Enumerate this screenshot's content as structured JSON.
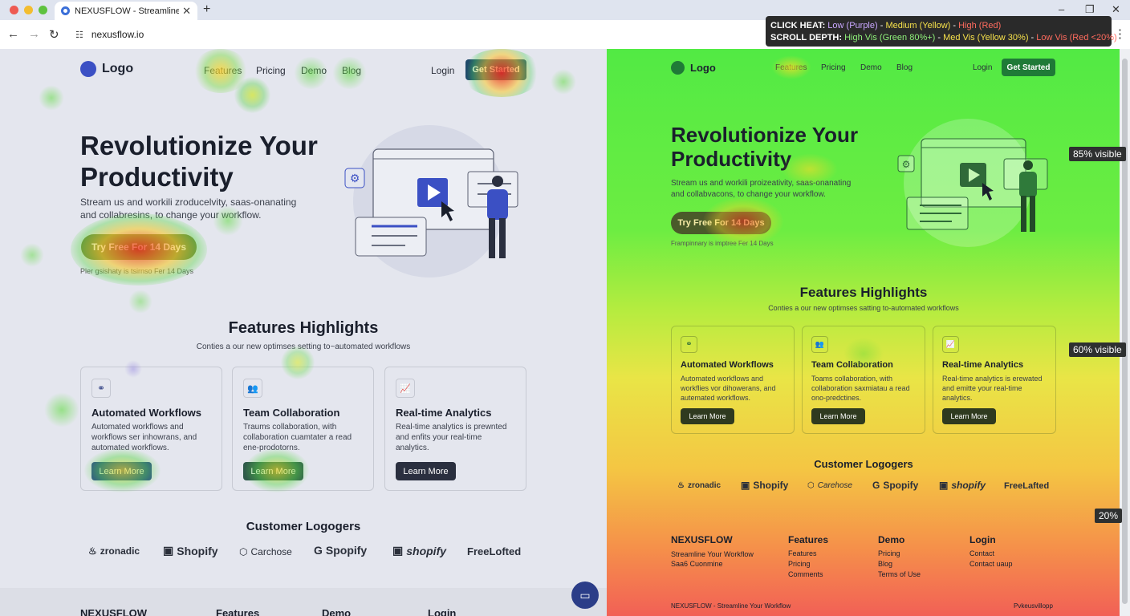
{
  "browser": {
    "tab_title": "NEXUSFLOW - Streamline Your Workflow",
    "new_tab": "+",
    "url": "nexusflow.io",
    "window_controls": [
      "–",
      "❐",
      "✕"
    ],
    "nav_buttons": [
      "←",
      "→",
      "↻"
    ],
    "menu": "⋮"
  },
  "legend": {
    "click_heat_label": "CLICK HEAT:",
    "click_low": "Low (Purple)",
    "click_med": "Medium (Yellow)",
    "click_high": "High (Red)",
    "scroll_label": "SCROLL DEPTH:",
    "scroll_high": "High Vis (Green 80%+)",
    "scroll_med": "Med Vis (Yellow 30%)",
    "scroll_low": "Low Vis (Red <20%)",
    "sep": " - ",
    "colors": {
      "low": "#c9a7ff",
      "med": "#f6e14b",
      "high": "#ff6b5e",
      "scroll_high": "#8ff07a"
    }
  },
  "site": {
    "logo": "Logo",
    "nav": [
      "Features",
      "Pricing",
      "Demo",
      "Blog"
    ],
    "login": "Login",
    "get_started": "Get Started",
    "get_started_left": "Get Started",
    "hero_title_1": "Revolutionize Your",
    "hero_title_2": "Productivity",
    "hero_sub_left_1": "Stream us and workili zroducelvity, saas-onanating",
    "hero_sub_left_2": "and collabresins, to change your workflow.",
    "hero_sub_right_1": "Stream us and workili proizeativity, saas-onanating",
    "hero_sub_right_2": "and collabvacons, to change your workflow.",
    "cta": "Try Free For 14 Days",
    "note_left": "Pler gsishaty is tsirnso Fer 14 Days",
    "note_right": "Frampinnary is imptree Fer 14 Days",
    "features_title": "Features Highlights",
    "features_sub_left": "Conties a our new optimses setting to~automated workflows",
    "features_sub_right": "Conties a our new optimses satting to-automated workflows",
    "cards_left": [
      {
        "icon": "share-nodes-icon",
        "glyph": "⚭",
        "title": "Automated Workflows",
        "lines": [
          "Automated workflows and",
          "workflows ser inhowrans, and",
          "automated workflows."
        ],
        "button": "Learn More"
      },
      {
        "icon": "users-icon",
        "glyph": "👥",
        "title": "Team Collaboration",
        "lines": [
          "Traums collaboration, with",
          "collaboration cuamtater a read",
          "ene-prodotorns."
        ],
        "button": "Learn More"
      },
      {
        "icon": "line-chart-icon",
        "glyph": "📈",
        "title": "Real-time Analytics",
        "lines": [
          "Real-time analytics is prewnted",
          "and enfits your real-time",
          "analytics."
        ],
        "button": "Learn More"
      }
    ],
    "cards_right": [
      {
        "icon": "share-nodes-icon",
        "glyph": "⚭",
        "title": "Automated Workflows",
        "lines": [
          "Automated workflows and",
          "workflies vor dihowerans, and",
          "autemated workflows."
        ],
        "button": "Learn More"
      },
      {
        "icon": "users-icon",
        "glyph": "👥",
        "title": "Team Collaboration",
        "lines": [
          "Toams collaboration, with",
          "collaboration saxmiatau a read",
          "ono-predctines."
        ],
        "button": "Learn More"
      },
      {
        "icon": "line-chart-icon",
        "glyph": "📈",
        "title": "Real-time Analytics",
        "lines": [
          "Real-time analytics is erewated",
          "and emitte your real-time",
          "analytics."
        ],
        "button": "Learn More"
      }
    ],
    "customers_title": "Customer Logogers",
    "customer_logos_left": [
      "zronadic",
      "Shopify",
      "Carchose",
      "Spopify",
      "shopify",
      "FreeLofted"
    ],
    "customer_logos_right": [
      "zronadic",
      "Shopify",
      "Carehose",
      "Spopify",
      "shopify",
      "FreeLafted"
    ],
    "footer_headings": [
      "NEXUSFLOW",
      "Features",
      "Demo",
      "Login"
    ],
    "footer_col1": [
      "Streamline Your Workflow",
      "Saa6 Cuonmine"
    ],
    "footer_col2": [
      "Features",
      "Pricing",
      "Comments"
    ],
    "footer_col3": [
      "Pricing",
      "Blog",
      "Terms of Use"
    ],
    "footer_col4": [
      "Contact",
      "Contact uaup"
    ],
    "footer_bottom": "NEXUSFLOW - Streamline Your Workflow",
    "footer_bottom_right": "Pvkeusvillopp"
  },
  "scroll_badges": [
    "85% visible",
    "60% visible",
    "20%"
  ],
  "colors": {
    "accent": "#1f7a37",
    "brand_blue": "#3b50c4",
    "dark_button": "#2a2f3f"
  }
}
